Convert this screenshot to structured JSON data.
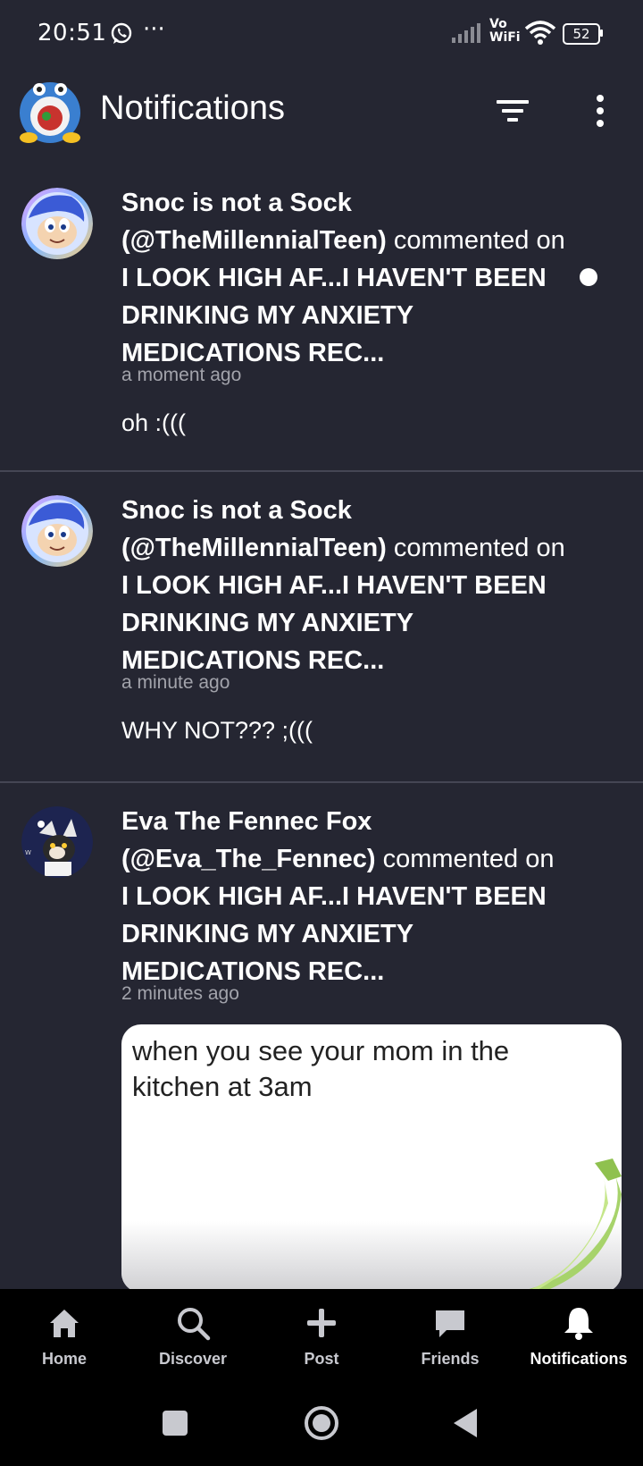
{
  "status_bar": {
    "time": "20:51",
    "extra_icons": "···",
    "network_label": "Vo WiFi",
    "battery": "52"
  },
  "header": {
    "title": "Notifications",
    "filter_icon": "filter-icon",
    "menu_icon": "more-vertical-icon"
  },
  "notifications": [
    {
      "user_name": "Snoc is not a Sock",
      "handle": "(@TheMillennialTeen)",
      "action": "commented",
      "on_word": "on",
      "post_title": "I LOOK HIGH AF...I HAVEN'T BEEN DRINKING MY ANXIETY MEDICATIONS REC...",
      "time": "a moment ago",
      "comment": "oh :(((",
      "unread": true
    },
    {
      "user_name": "Snoc is not a Sock",
      "handle": "(@TheMillennialTeen)",
      "action": "commented",
      "on_word": "on",
      "post_title": "I LOOK HIGH AF...I HAVEN'T BEEN DRINKING MY ANXIETY MEDICATIONS REC...",
      "time": "a minute ago",
      "comment": "WHY NOT??? ;(((",
      "unread": false
    },
    {
      "user_name": "Eva The Fennec Fox",
      "handle": "(@Eva_The_Fennec)",
      "action": "commented",
      "on_word": "on",
      "post_title": "I LOOK HIGH AF...I HAVEN'T BEEN DRINKING MY ANXIETY MEDICATIONS REC...",
      "time": "2 minutes ago",
      "image_caption": "when you see your mom in the kitchen at 3am",
      "unread": false
    }
  ],
  "bottom_nav": [
    {
      "label": "Home",
      "icon": "home-icon"
    },
    {
      "label": "Discover",
      "icon": "search-icon"
    },
    {
      "label": "Post",
      "icon": "plus-icon"
    },
    {
      "label": "Friends",
      "icon": "chat-icon"
    },
    {
      "label": "Notifications",
      "icon": "bell-icon",
      "active": true
    }
  ],
  "colors": {
    "background": "#252632",
    "divider": "#454654",
    "nav_background": "#000000",
    "muted_text": "#a2a3ab"
  }
}
